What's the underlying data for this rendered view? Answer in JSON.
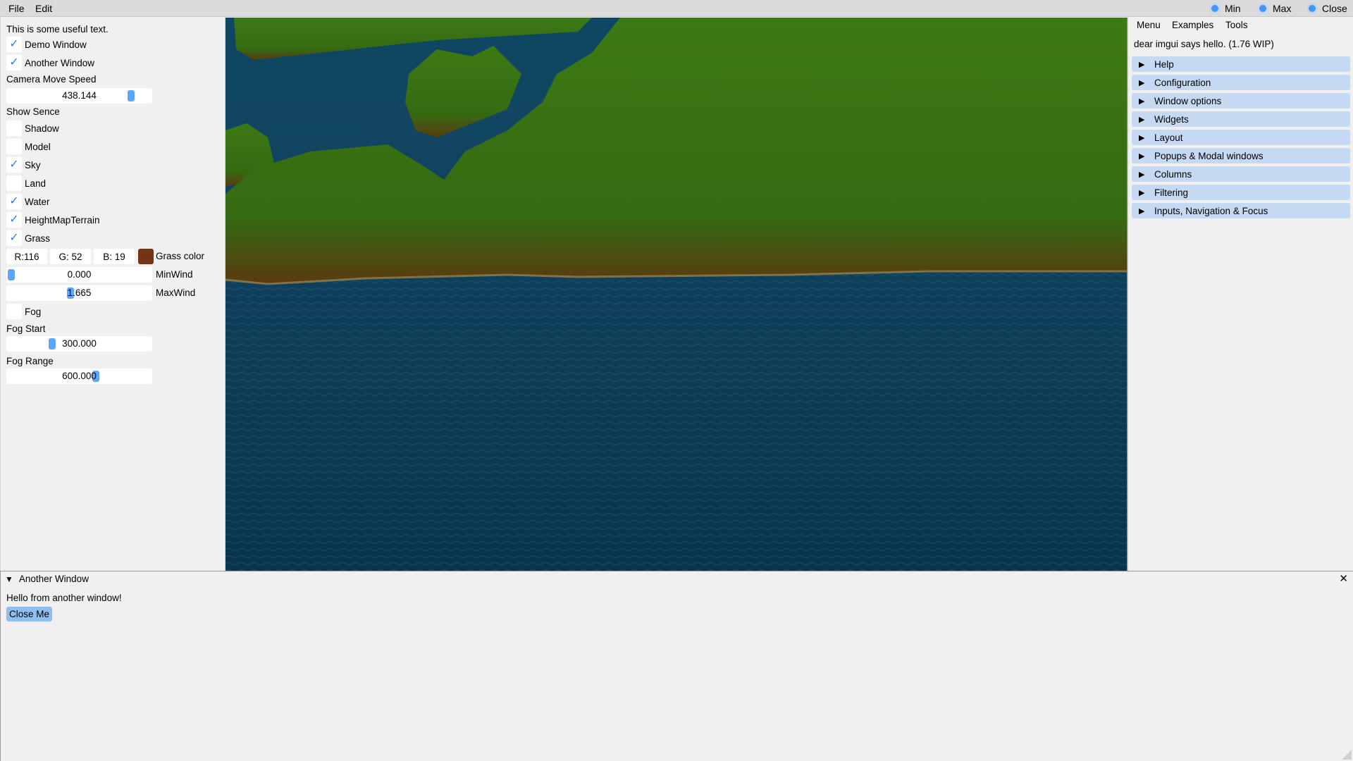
{
  "menubar": {
    "items": [
      "File",
      "Edit"
    ],
    "window_buttons": [
      "Min",
      "Max",
      "Close"
    ]
  },
  "left_panel": {
    "useful_text": "This is some useful text.",
    "demo_window": {
      "label": "Demo Window",
      "checked": true
    },
    "another_window": {
      "label": "Another Window",
      "checked": true
    },
    "camera_speed_label": "Camera Move Speed",
    "camera_speed": {
      "value": "438.144",
      "fraction": 0.86
    },
    "show_scene_label": "Show Sence",
    "scene_toggles": [
      {
        "label": "Shadow",
        "checked": false
      },
      {
        "label": "Model",
        "checked": false
      },
      {
        "label": "Sky",
        "checked": true
      },
      {
        "label": "Land",
        "checked": false
      },
      {
        "label": "Water",
        "checked": true
      },
      {
        "label": "HeightMapTerrain",
        "checked": true
      },
      {
        "label": "Grass",
        "checked": true
      }
    ],
    "grass_color": {
      "r": "R:116",
      "g": "G: 52",
      "b": "B: 19",
      "swatch": "#743413",
      "label": "Grass color"
    },
    "min_wind": {
      "value": "0.000",
      "fraction": 0.0,
      "label": "MinWind"
    },
    "max_wind": {
      "value": "1.665",
      "fraction": 0.44,
      "label": "MaxWind"
    },
    "fog": {
      "label": "Fog",
      "checked": false
    },
    "fog_start_label": "Fog Start",
    "fog_start": {
      "value": "300.000",
      "fraction": 0.3
    },
    "fog_range_label": "Fog Range",
    "fog_range": {
      "value": "600.000",
      "fraction": 0.6
    }
  },
  "right_panel": {
    "menu": [
      "Menu",
      "Examples",
      "Tools"
    ],
    "hello": "dear imgui says hello. (1.76 WIP)",
    "headers": [
      "Help",
      "Configuration",
      "Window options",
      "Widgets",
      "Layout",
      "Popups & Modal windows",
      "Columns",
      "Filtering",
      "Inputs, Navigation & Focus"
    ]
  },
  "another_window": {
    "title": "Another Window",
    "text": "Hello from another window!",
    "button": "Close Me",
    "close_glyph": "✕"
  },
  "colors": {
    "accent": "#4296fa",
    "header_bg": "#c5daf2",
    "water": "#0b3a57",
    "grass": "#3f7a16"
  }
}
